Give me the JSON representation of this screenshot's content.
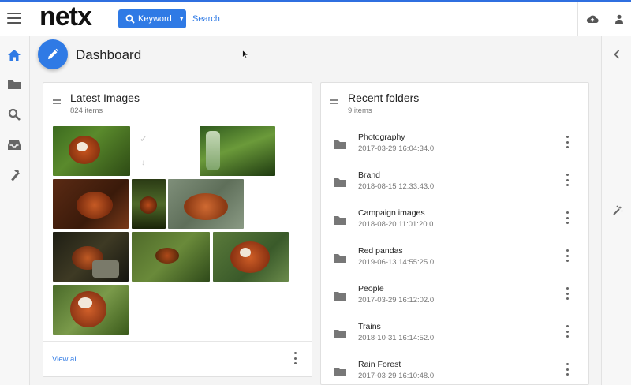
{
  "header": {
    "logo": "netx",
    "keyword_label": "Keyword",
    "search_placeholder": "Search"
  },
  "page": {
    "title": "Dashboard"
  },
  "latest_images": {
    "title": "Latest Images",
    "count": "824 items",
    "view_all": "View all"
  },
  "recent_folders": {
    "title": "Recent folders",
    "count": "9 items",
    "items": [
      {
        "name": "Photography",
        "date": "2017-03-29 16:04:34.0"
      },
      {
        "name": "Brand",
        "date": "2018-08-15 12:33:43.0"
      },
      {
        "name": "Campaign images",
        "date": "2018-08-20 11:01:20.0"
      },
      {
        "name": "Red pandas",
        "date": "2019-06-13 14:55:25.0"
      },
      {
        "name": "People",
        "date": "2017-03-29 16:12:02.0"
      },
      {
        "name": "Trains",
        "date": "2018-10-31 16:14:52.0"
      },
      {
        "name": "Rain Forest",
        "date": "2017-03-29 16:10:48.0"
      }
    ]
  },
  "colors": {
    "accent": "#2f7ae5",
    "top_stripe": "#2f6fe0"
  }
}
